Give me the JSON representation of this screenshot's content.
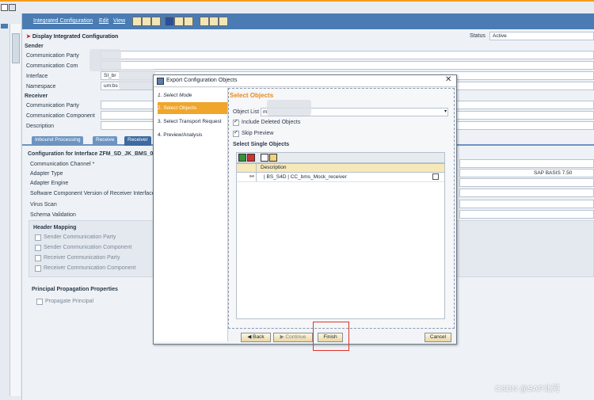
{
  "window": {
    "menu_integrated_config": "Integrated Configuration",
    "menu_edit": "Edit",
    "menu_view": "View"
  },
  "page": {
    "title": "Display Integrated Configuration",
    "status_label": "Status",
    "status_value": "Active",
    "sender_heading": "Sender",
    "sender_fields": [
      "Communication Party",
      "Communication Com",
      "Interface",
      "Namespace"
    ],
    "interface_value": "SI_br",
    "namespace_value": "um:bs",
    "receiver_heading": "Receiver",
    "receiver_fields": [
      "Communication Party",
      "Communication Component",
      "Description"
    ],
    "tabs": [
      "Inbound Processing",
      "Receive",
      "Receiver"
    ],
    "config_heading": "Configuration for Interface ZFM_SD_JK_BMS_002",
    "config_fields": [
      "Communication Channel *",
      "Adapter Type",
      "Adapter Engine",
      "Software Component Version of Receiver Interface",
      "Virus Scan",
      "Schema Validation"
    ],
    "adapter_type_value": "SAP BASIS 7.50",
    "header_mapping_heading": "Header Mapping",
    "header_mapping_items": [
      "Sender Communication Party",
      "Sender Communication Component",
      "Receiver Communication Party",
      "Receiver Communication Component"
    ],
    "principal_heading": "Principal Propagation Properties",
    "principal_item": "Propagate Principal"
  },
  "dialog": {
    "title": "Export Configuration Objects",
    "steps": [
      "1. Select Mode",
      "2. Select Objects",
      "3. Select Transport Request",
      "4. Preview/Analysis"
    ],
    "active_step": 1,
    "section_title": "Select Objects",
    "object_list_label": "Object List",
    "object_list_value": "m",
    "include_deleted_label": "Include Deleted Objects",
    "skip_preview_label": "Skip Preview",
    "single_objects_label": "Select Single Objects",
    "table_header": "Description",
    "table_rows": [
      "| BS_S4D | CC_bms_Mock_receiver"
    ],
    "buttons": {
      "back": "Back",
      "continue": "Continue",
      "finish": "Finish",
      "cancel": "Cancel"
    }
  },
  "watermark": "CSDN @SAP北河",
  "colors": {
    "highlight_box": "#e0322b",
    "active_step": "#f0a52b",
    "header_blue": "#4a7cb3"
  }
}
